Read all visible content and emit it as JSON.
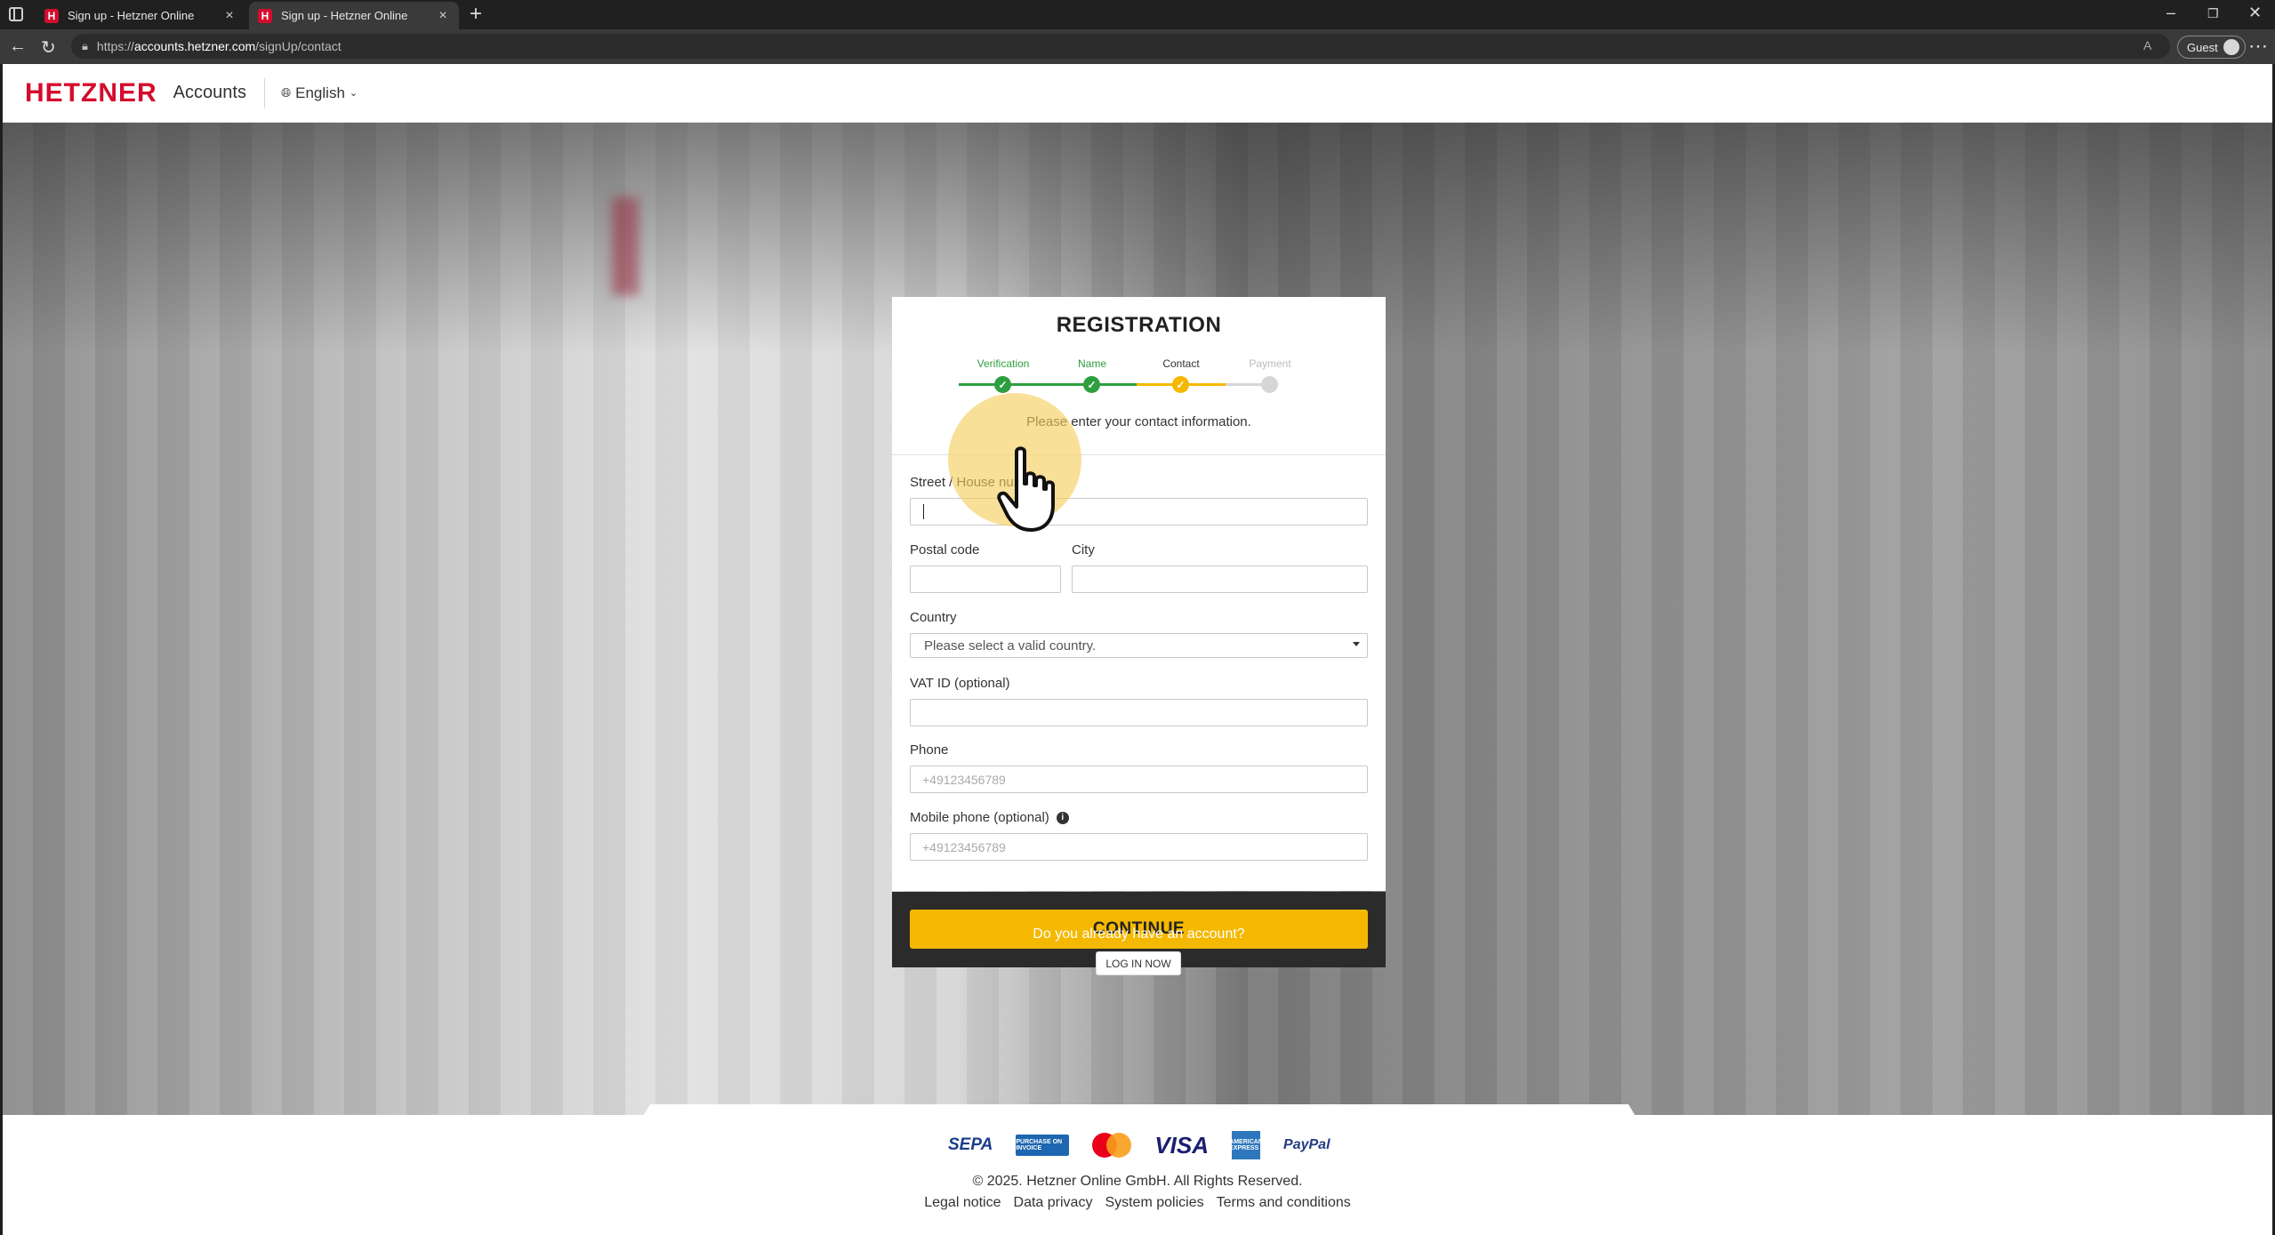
{
  "browser": {
    "tabs": [
      {
        "title": "Sign up - Hetzner Online",
        "active": false
      },
      {
        "title": "Sign up - Hetzner Online",
        "active": true
      }
    ],
    "url_prefix": "https://",
    "url_host": "accounts.hetzner.com",
    "url_path": "/signUp/contact",
    "profile_label": "Guest"
  },
  "header": {
    "logo_text": "HETZNER",
    "app_name": "Accounts",
    "language": "English"
  },
  "registration": {
    "title": "REGISTRATION",
    "steps": [
      {
        "label": "Verification",
        "state": "done"
      },
      {
        "label": "Name",
        "state": "done"
      },
      {
        "label": "Contact",
        "state": "current"
      },
      {
        "label": "Payment",
        "state": "pending"
      }
    ],
    "instruction": "Please enter your contact information.",
    "fields": {
      "street_label": "Street / House number",
      "street_value": "",
      "postal_label": "Postal code",
      "postal_value": "",
      "city_label": "City",
      "city_value": "",
      "country_label": "Country",
      "country_value": "Please select a valid country.",
      "vat_label": "VAT ID (optional)",
      "vat_value": "",
      "phone_label": "Phone",
      "phone_placeholder": "+49123456789",
      "mobile_label": "Mobile phone (optional)",
      "mobile_placeholder": "+49123456789"
    },
    "continue_label": "CONTINUE",
    "already_account": "Do you already have an account?",
    "login_label": "LOG IN NOW"
  },
  "colors": {
    "brand_red": "#d50c2d",
    "accent_yellow": "#f5b800",
    "step_done": "#2e9e3e",
    "step_pending": "#d6d6d6"
  },
  "footer": {
    "payment_methods": [
      "SEPA",
      "PURCHASE ON INVOICE",
      "mastercard",
      "VISA",
      "AMERICAN EXPRESS",
      "PayPal"
    ],
    "copyright": "© 2025. Hetzner Online GmbH. All Rights Reserved.",
    "links": [
      "Legal notice",
      "Data privacy",
      "System policies",
      "Terms and conditions"
    ]
  }
}
